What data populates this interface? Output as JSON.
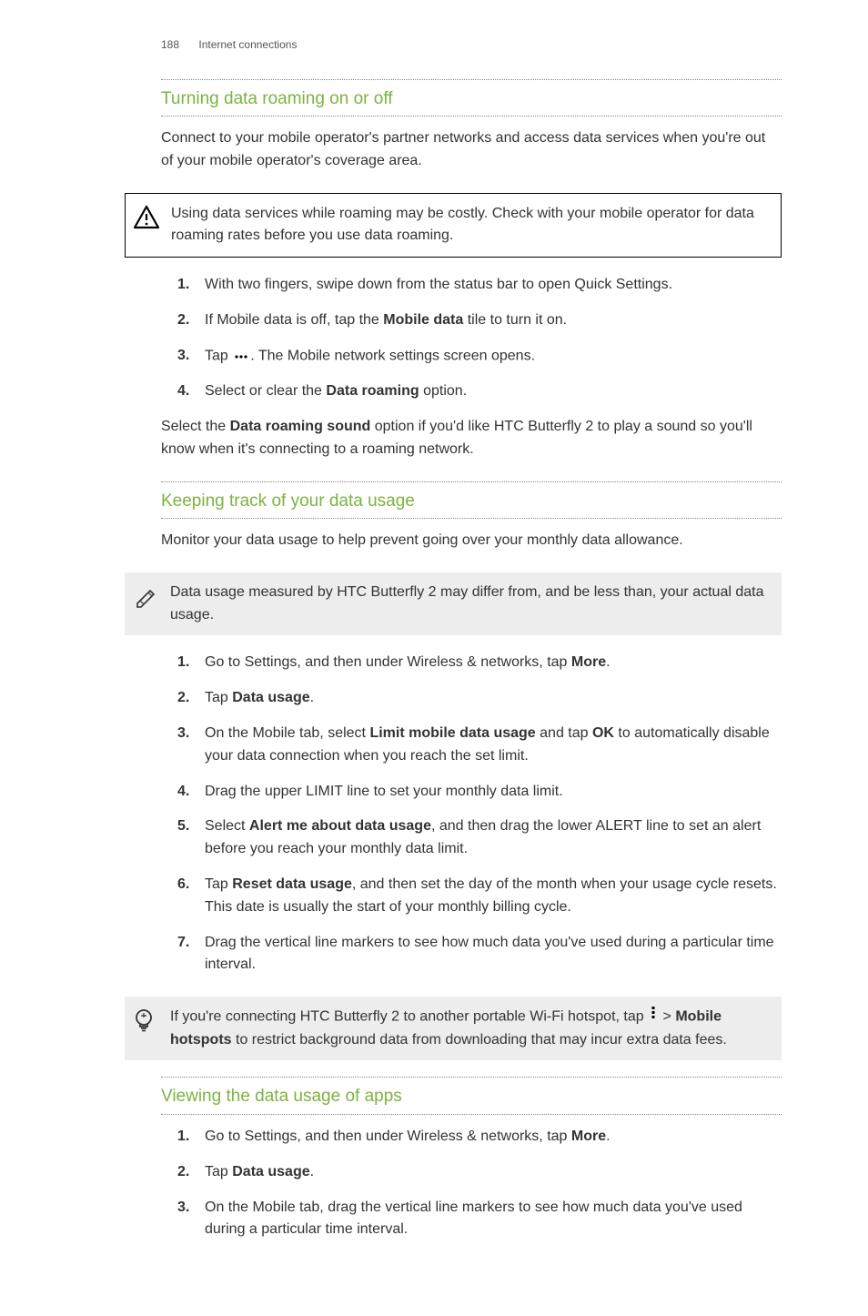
{
  "header": {
    "page_number": "188",
    "chapter": "Internet connections"
  },
  "section1": {
    "title": "Turning data roaming on or off",
    "intro": "Connect to your mobile operator's partner networks and access data services when you're out of your mobile operator's coverage area.",
    "warn": "Using data services while roaming may be costly. Check with your mobile operator for data roaming rates before you use data roaming.",
    "step1": "With two fingers, swipe down from the status bar to open Quick Settings.",
    "step2a": "If Mobile data is off, tap the ",
    "step2b": "Mobile data",
    "step2c": " tile to turn it on.",
    "step3a": "Tap ",
    "step3b": ". The Mobile network settings screen opens.",
    "step4a": "Select or clear the ",
    "step4b": "Data roaming",
    "step4c": " option.",
    "outro_a": "Select the ",
    "outro_b": "Data roaming sound",
    "outro_c": " option if you'd like HTC Butterfly 2 to play a sound so you'll know when it's connecting to a roaming network."
  },
  "section2": {
    "title": "Keeping track of your data usage",
    "intro": "Monitor your data usage to help prevent going over your monthly data allowance.",
    "note": "Data usage measured by HTC Butterfly 2 may differ from, and be less than, your actual data usage.",
    "step1a": "Go to Settings, and then under Wireless & networks, tap ",
    "step1b": "More",
    "step1c": ".",
    "step2a": "Tap ",
    "step2b": "Data usage",
    "step2c": ".",
    "step3a": "On the Mobile tab, select ",
    "step3b": "Limit mobile data usage",
    "step3c": " and tap ",
    "step3d": "OK",
    "step3e": " to automatically disable your data connection when you reach the set limit.",
    "step4": "Drag the upper LIMIT line to set your monthly data limit.",
    "step5a": "Select ",
    "step5b": "Alert me about data usage",
    "step5c": ", and then drag the lower ALERT line to set an alert before you reach your monthly data limit.",
    "step6a": "Tap ",
    "step6b": "Reset data usage",
    "step6c": ", and then set the day of the month when your usage cycle resets. This date is usually the start of your monthly billing cycle.",
    "step7": "Drag the vertical line markers to see how much data you've used during a particular time interval.",
    "tip_a": "If you're connecting HTC Butterfly 2 to another portable Wi-Fi hotspot, tap ",
    "tip_b": " > ",
    "tip_c": "Mobile hotspots",
    "tip_d": " to restrict background data from downloading that may incur extra data fees."
  },
  "section3": {
    "title": "Viewing the data usage of apps",
    "step1a": "Go to Settings, and then under Wireless & networks, tap ",
    "step1b": "More",
    "step1c": ".",
    "step2a": "Tap ",
    "step2b": "Data usage",
    "step2c": ".",
    "step3": "On the Mobile tab, drag the vertical line markers to see how much data you've used during a particular time interval."
  }
}
